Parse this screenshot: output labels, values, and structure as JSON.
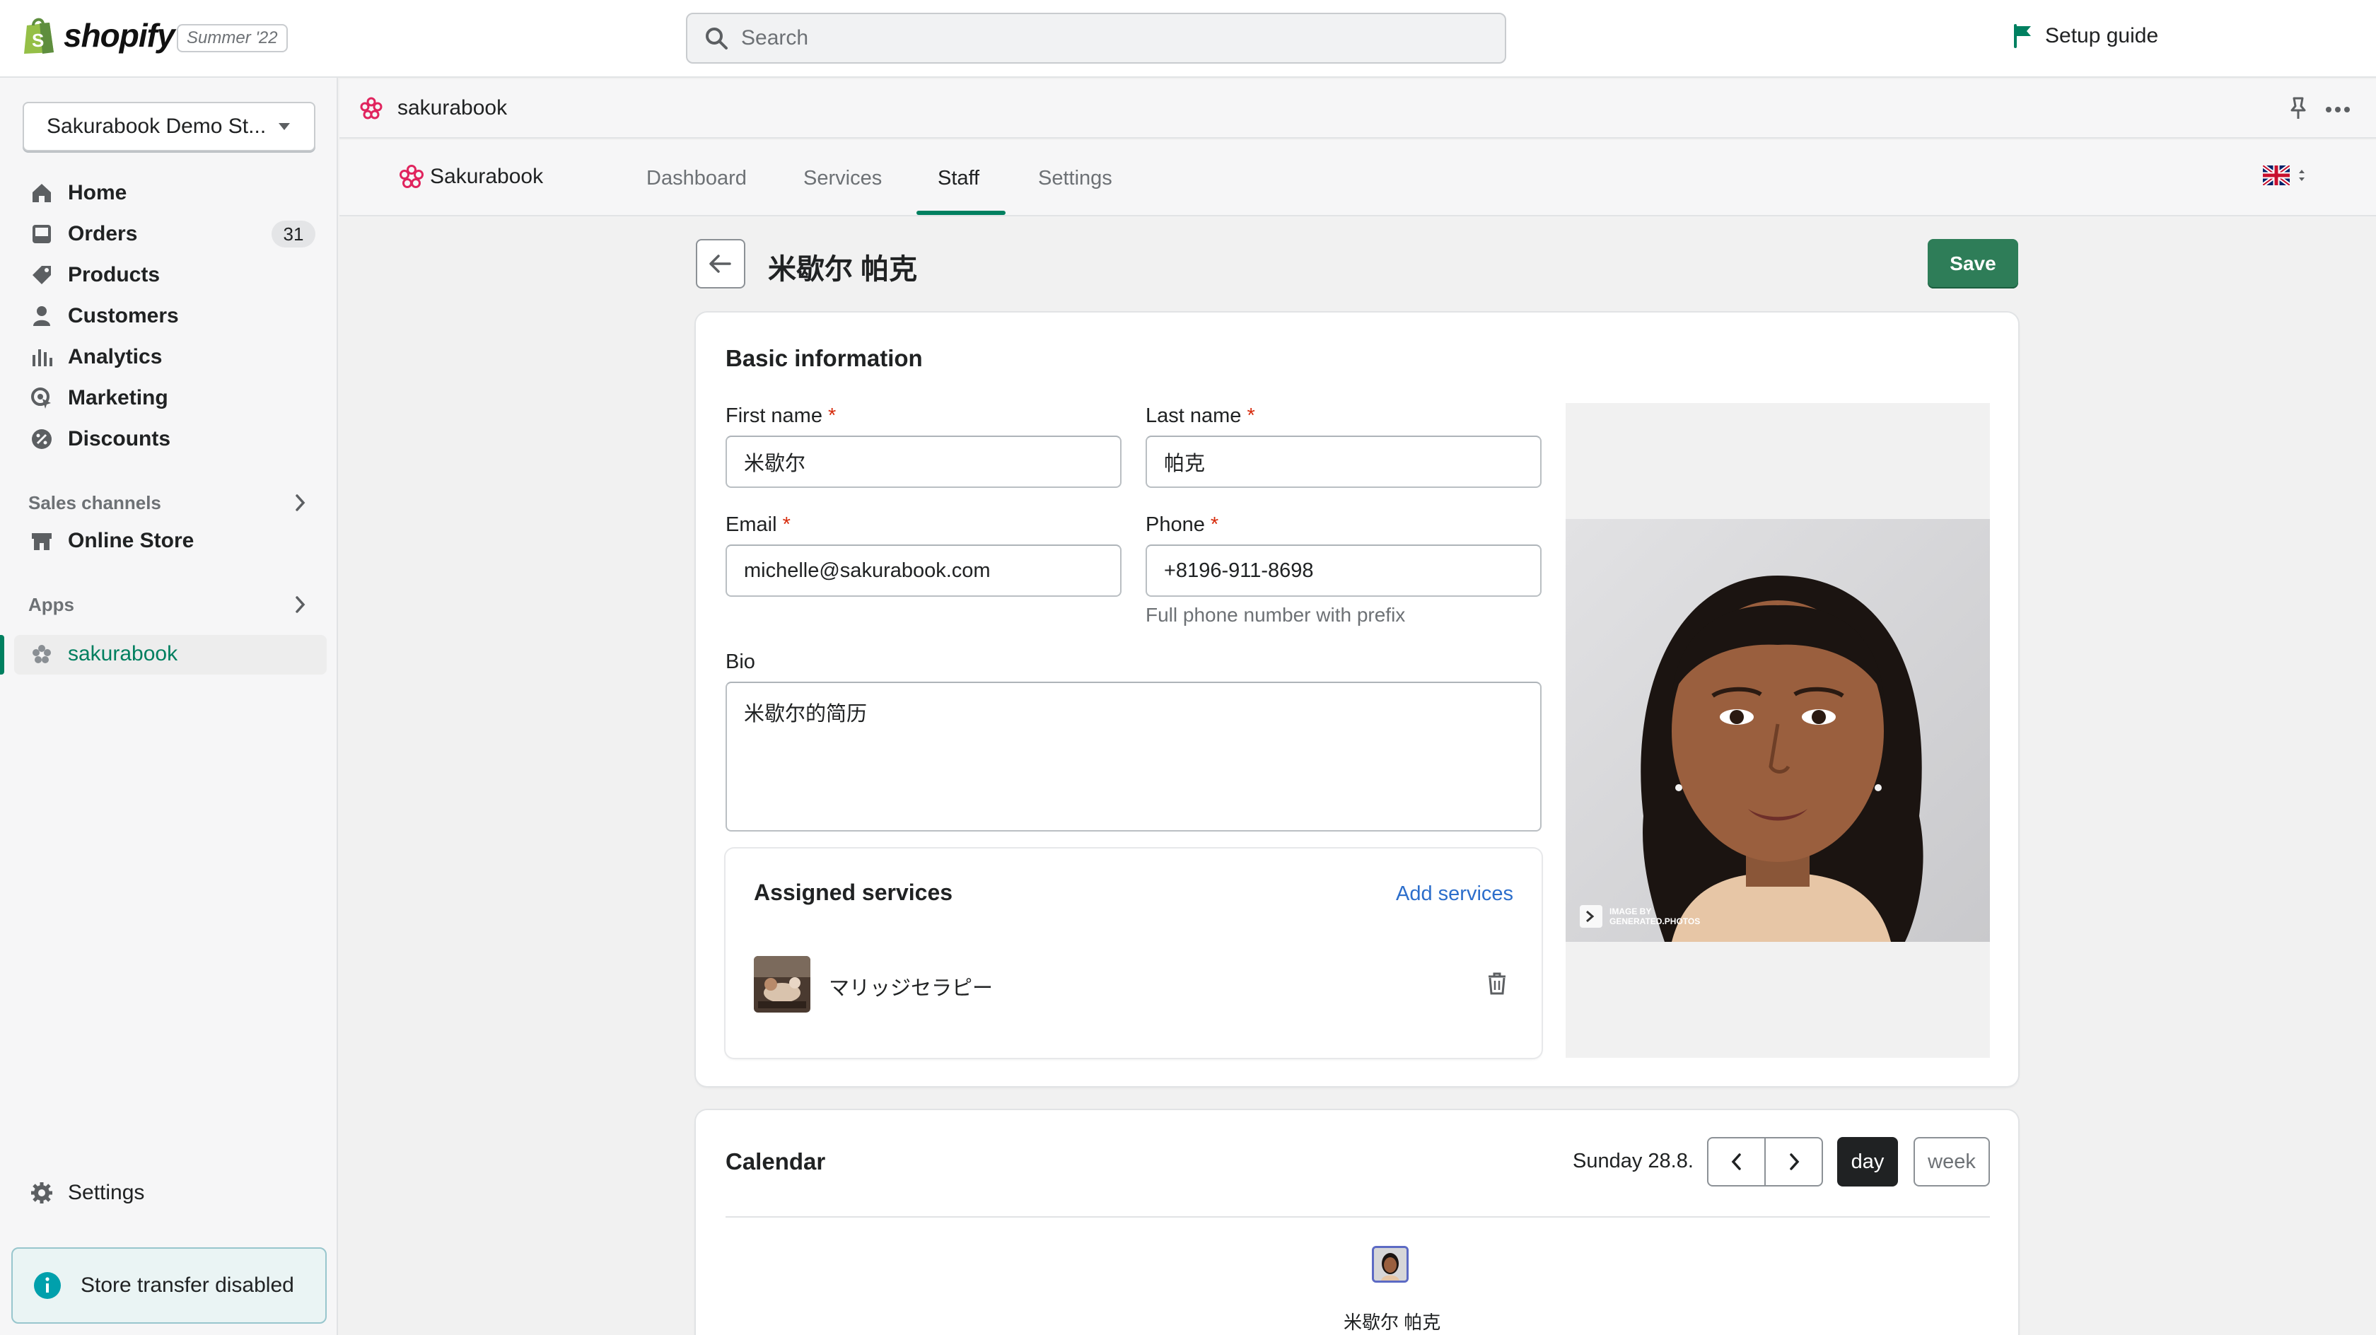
{
  "topbar": {
    "logo_text": "shopify",
    "edition": "Summer '22",
    "search_placeholder": "Search",
    "setup_guide": "Setup guide"
  },
  "sidebar": {
    "store_name": "Sakurabook Demo St...",
    "items": [
      {
        "label": "Home",
        "icon": "home-icon"
      },
      {
        "label": "Orders",
        "icon": "orders-icon",
        "badge": "31"
      },
      {
        "label": "Products",
        "icon": "tag-icon"
      },
      {
        "label": "Customers",
        "icon": "person-icon"
      },
      {
        "label": "Analytics",
        "icon": "bar-chart-icon"
      },
      {
        "label": "Marketing",
        "icon": "marketing-icon"
      },
      {
        "label": "Discounts",
        "icon": "discount-icon"
      }
    ],
    "sales_channels_label": "Sales channels",
    "online_store": "Online Store",
    "apps_label": "Apps",
    "app_active": "sakurabook",
    "settings": "Settings",
    "store_transfer": "Store transfer disabled"
  },
  "app_header": {
    "name": "sakurabook"
  },
  "app_nav": {
    "brand": "Sakurabook",
    "tabs": [
      "Dashboard",
      "Services",
      "Staff",
      "Settings"
    ],
    "active_tab": "Staff"
  },
  "page": {
    "title": "米歇尔 帕克",
    "save": "Save"
  },
  "basic": {
    "title": "Basic information",
    "first_name_label": "First name",
    "first_name": "米歇尔",
    "last_name_label": "Last name",
    "last_name": "帕克",
    "email_label": "Email",
    "email": "michelle@sakurabook.com",
    "phone_label": "Phone",
    "phone": "+8196-911-8698",
    "phone_help": "Full phone number with prefix",
    "bio_label": "Bio",
    "bio": "米歇尔的简历",
    "required_mark": "*",
    "photo_watermark_1": "IMAGE BY",
    "photo_watermark_2": "GENERATED.PHOTOS"
  },
  "assigned": {
    "title": "Assigned services",
    "add": "Add services",
    "services": [
      {
        "name": "マリッジセラピー"
      }
    ]
  },
  "calendar": {
    "title": "Calendar",
    "date": "Sunday 28.8.",
    "day": "day",
    "week": "week",
    "person": "米歇尔 帕克"
  },
  "colors": {
    "accent": "#008060",
    "save": "#2e7d58",
    "link": "#2c6ecb",
    "sakura": "#e0245e"
  }
}
